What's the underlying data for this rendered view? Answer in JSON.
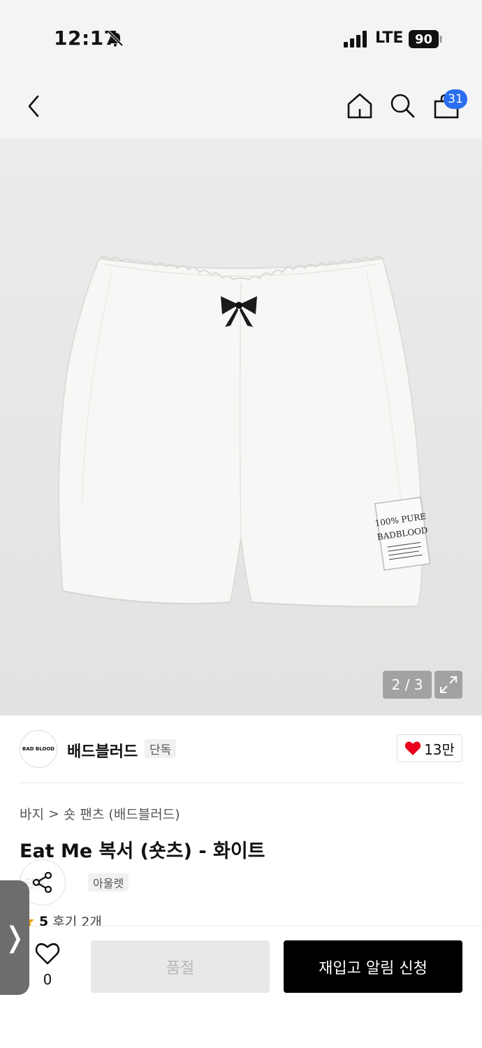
{
  "status": {
    "time": "12:17",
    "network": "LTE",
    "battery": "90"
  },
  "nav": {
    "cart_count": "31"
  },
  "gallery": {
    "counter": "2 / 3",
    "garment_label_line1": "100% PURE",
    "garment_label_line2": "BADBLOOD"
  },
  "brand": {
    "logo_text": "BAD BLOOD",
    "name": "배드블러드",
    "tag": "단독",
    "likes": "13만"
  },
  "breadcrumb": {
    "category": "바지",
    "separator": ">",
    "subcategory": "숏 팬츠 (배드블러드)"
  },
  "product": {
    "title": "Eat Me 복서 (숏츠) - 화이트"
  },
  "tags": [
    "단독",
    "아울렛"
  ],
  "rating": {
    "score": "5",
    "reviews": "후기 2개"
  },
  "bottom": {
    "wish_count": "0",
    "soldout_label": "품절",
    "restock_label": "재입고 알림 신청"
  },
  "drawer": {
    "handle_glyph": "❭"
  },
  "colors": {
    "accent": "#2a6ef0",
    "heart": "#e8001c",
    "primary_button": "#000000"
  }
}
